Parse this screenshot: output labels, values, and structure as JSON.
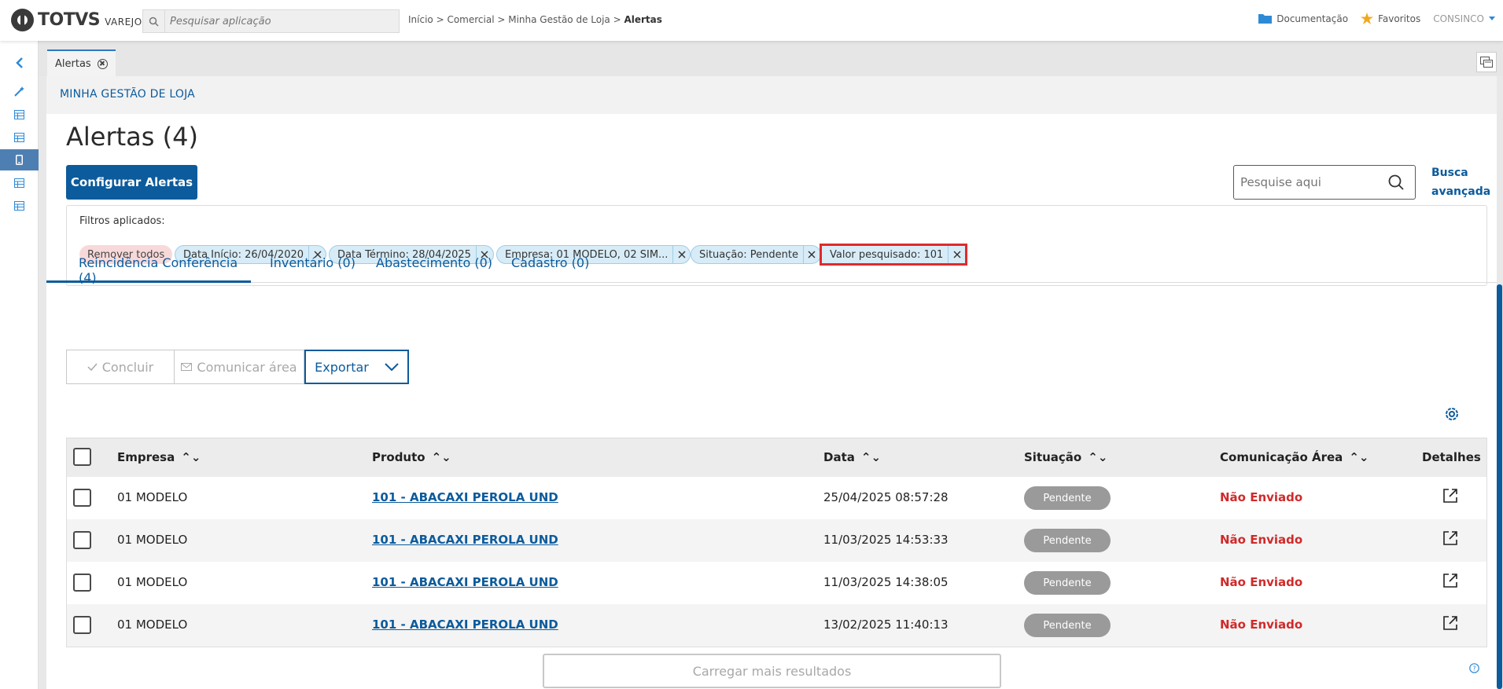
{
  "header": {
    "logo_word": "TOTVS",
    "logo_sub": "VAREJO",
    "search_placeholder": "Pesquisar aplicação",
    "breadcrumb": [
      "Início",
      "Comercial",
      "Minha Gestão de Loja",
      "Alertas"
    ],
    "breadcrumb_sep": " > ",
    "documentation": "Documentação",
    "favorites": "Favoritos",
    "user": "CONSINCO"
  },
  "tabstrip": {
    "tab_label": "Alertas"
  },
  "module": {
    "title": "MINHA GESTÃO DE LOJA"
  },
  "page": {
    "title": "Alertas (4)",
    "config_button": "Configurar Alertas",
    "search_placeholder": "Pesquise aqui",
    "advanced_search_line1": "Busca",
    "advanced_search_line2": "avançada"
  },
  "filters": {
    "label": "Filtros aplicados:",
    "remove_all": "Remover todos",
    "chips": [
      "Data Início: 26/04/2020",
      "Data Término: 28/04/2025",
      "Empresa: 01 MODELO, 02 SIM...",
      "Situação: Pendente",
      "Valor pesquisado: 101"
    ]
  },
  "tabs": [
    "Reincidência Conferência (4)",
    "Inventário (0)",
    "Abastecimento (0)",
    "Cadastro (0)"
  ],
  "toolbar": {
    "conclude": "Concluir",
    "communicate": "Comunicar área",
    "export": "Exportar"
  },
  "table": {
    "columns": [
      "Empresa",
      "Produto",
      "Data",
      "Situação",
      "Comunicação Área",
      "Detalhes"
    ],
    "rows": [
      {
        "empresa": "01 MODELO",
        "produto": "101 - ABACAXI PEROLA UND",
        "data": "25/04/2025 08:57:28",
        "situacao": "Pendente",
        "comunicacao": "Não Enviado"
      },
      {
        "empresa": "01 MODELO",
        "produto": "101 - ABACAXI PEROLA UND",
        "data": "11/03/2025 14:53:33",
        "situacao": "Pendente",
        "comunicacao": "Não Enviado"
      },
      {
        "empresa": "01 MODELO",
        "produto": "101 - ABACAXI PEROLA UND",
        "data": "11/03/2025 14:38:05",
        "situacao": "Pendente",
        "comunicacao": "Não Enviado"
      },
      {
        "empresa": "01 MODELO",
        "produto": "101 - ABACAXI PEROLA UND",
        "data": "13/02/2025 11:40:13",
        "situacao": "Pendente",
        "comunicacao": "Não Enviado"
      }
    ]
  },
  "load_more": "Carregar mais resultados",
  "colors": {
    "primary": "#0c5b9c",
    "alert_red": "#d02a2a",
    "badge_gray": "#9a9a9a",
    "highlight_box": "#e02a2a"
  }
}
